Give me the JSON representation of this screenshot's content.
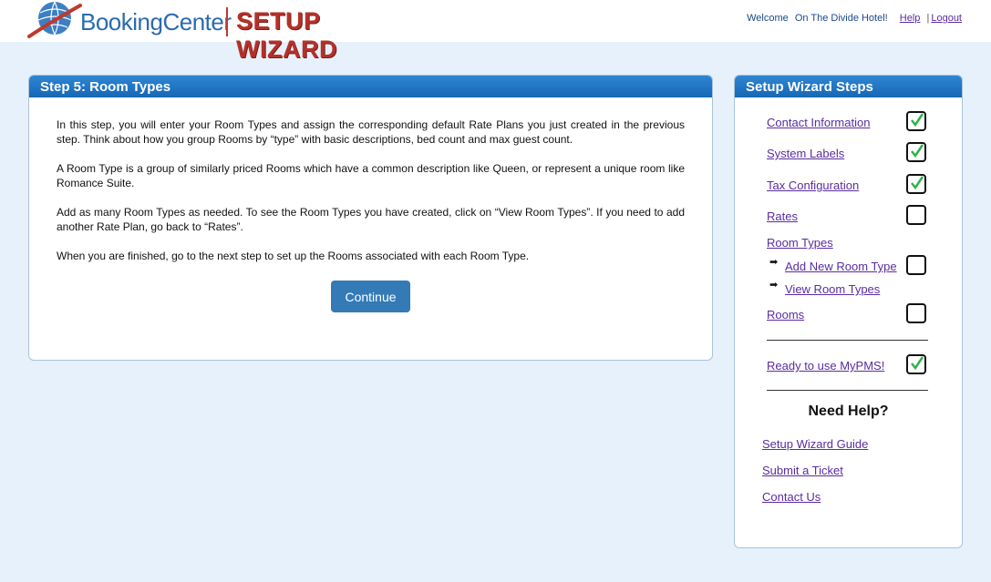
{
  "header": {
    "brand": "BookingCenter",
    "wizard_title": "SETUP WIZARD",
    "welcome_label": "Welcome",
    "hotel_name": "On The Divide Hotel!",
    "help_link": "Help",
    "separator": "|",
    "logout_link": "Logout"
  },
  "main": {
    "title": "Step 5: Room Types",
    "paragraphs": [
      "In this step, you will enter your Room Types and assign the corresponding default Rate Plans you just created in the previous step. Think about how you group Rooms by “type” with basic descriptions, bed count and max guest count.",
      "A Room Type is a group of similarly priced Rooms which have a common description like Queen, or represent a unique room like Romance Suite.",
      "Add as many Room Types as needed. To see the Room Types you have created, click on “View Room Types”. If you need to add another Rate Plan, go back to “Rates”.",
      "When you are finished, go to the next step to set up the Rooms associated with each Room Type."
    ],
    "continue_label": "Continue"
  },
  "sidebar": {
    "title": "Setup Wizard Steps",
    "steps": [
      {
        "label": "Contact Information",
        "checked": true
      },
      {
        "label": "System Labels",
        "checked": true
      },
      {
        "label": "Tax Configuration",
        "checked": true
      },
      {
        "label": "Rates",
        "checked": false
      },
      {
        "label": "Room Types"
      },
      {
        "label": "Add New Room Type",
        "checked": false
      },
      {
        "label": "View Room Types"
      },
      {
        "label": "Rooms",
        "checked": false
      },
      {
        "label": "Ready to use MyPMS!",
        "checked": true
      }
    ],
    "help_title": "Need Help?",
    "help_links": [
      "Setup Wizard Guide",
      "Submit a Ticket",
      "Contact Us"
    ],
    "check_color": "#2db34a"
  }
}
